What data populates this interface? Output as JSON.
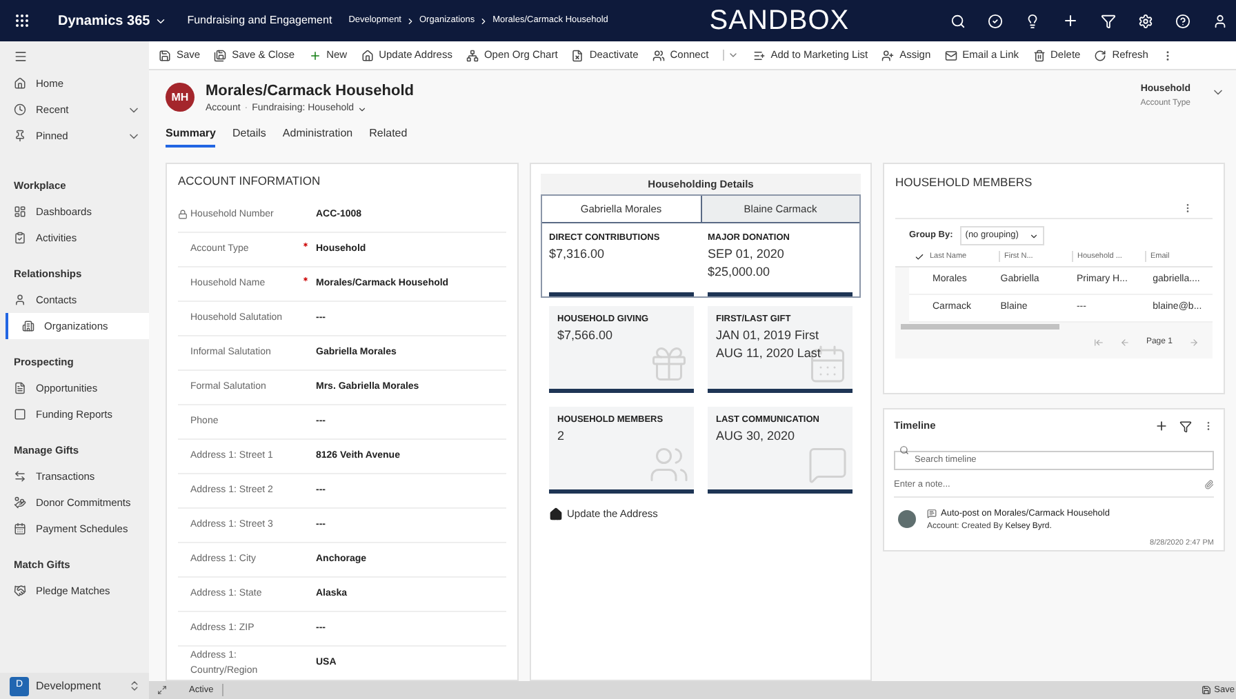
{
  "top_bar": {
    "app_name": "Dynamics 365",
    "area": "Fundraising and Engagement",
    "breadcrumbs": [
      "Development",
      "Organizations",
      "Morales/Carmack Household"
    ],
    "environment": "SANDBOX"
  },
  "command_bar": [
    "Save",
    "Save & Close",
    "New",
    "Update Address",
    "Open Org Chart",
    "Deactivate",
    "Connect",
    "Add to Marketing List",
    "Assign",
    "Email a Link",
    "Delete",
    "Refresh"
  ],
  "sidebar": {
    "top_items": [
      {
        "label": "Home",
        "expandable": false
      },
      {
        "label": "Recent",
        "expandable": true
      },
      {
        "label": "Pinned",
        "expandable": true
      }
    ],
    "groups": [
      {
        "title": "Workplace",
        "items": [
          {
            "label": "Dashboards",
            "selected": false
          },
          {
            "label": "Activities",
            "selected": false
          }
        ]
      },
      {
        "title": "Relationships",
        "items": [
          {
            "label": "Contacts",
            "selected": false
          },
          {
            "label": "Organizations",
            "selected": true
          }
        ]
      },
      {
        "title": "Prospecting",
        "items": [
          {
            "label": "Opportunities",
            "selected": false
          },
          {
            "label": "Funding Reports",
            "selected": false
          }
        ]
      },
      {
        "title": "Manage Gifts",
        "items": [
          {
            "label": "Transactions",
            "selected": false
          },
          {
            "label": "Donor Commitments",
            "selected": false
          },
          {
            "label": "Payment Schedules",
            "selected": false
          }
        ]
      },
      {
        "title": "Match Gifts",
        "items": [
          {
            "label": "Pledge Matches",
            "selected": false
          }
        ]
      }
    ],
    "area_switcher": {
      "badge": "D",
      "label": "Development"
    }
  },
  "record": {
    "initials": "MH",
    "title": "Morales/Carmack Household",
    "entity": "Account",
    "separator": "·",
    "form": "Fundraising: Household",
    "header_field": {
      "value": "Household",
      "label": "Account Type"
    }
  },
  "tabs": [
    {
      "label": "Summary",
      "selected": true
    },
    {
      "label": "Details",
      "selected": false
    },
    {
      "label": "Administration",
      "selected": false
    },
    {
      "label": "Related",
      "selected": false
    }
  ],
  "account_information": {
    "title": "ACCOUNT INFORMATION",
    "fields": [
      {
        "label": "Household Number",
        "value": "ACC-1008",
        "locked": true,
        "required": false
      },
      {
        "label": "Account Type",
        "value": "Household",
        "locked": false,
        "required": true
      },
      {
        "label": "Household Name",
        "value": "Morales/Carmack Household",
        "locked": false,
        "required": true
      },
      {
        "label": "Household Salutation",
        "value": "---",
        "locked": false,
        "required": false
      },
      {
        "label": "Informal Salutation",
        "value": "Gabriella Morales",
        "locked": false,
        "required": false
      },
      {
        "label": "Formal Salutation",
        "value": "Mrs. Gabriella Morales",
        "locked": false,
        "required": false
      },
      {
        "label": "Phone",
        "value": "---",
        "locked": false,
        "required": false
      },
      {
        "label": "Address 1: Street 1",
        "value": "8126 Veith Avenue",
        "locked": false,
        "required": false
      },
      {
        "label": "Address 1: Street 2",
        "value": "---",
        "locked": false,
        "required": false
      },
      {
        "label": "Address 1: Street 3",
        "value": "---",
        "locked": false,
        "required": false
      },
      {
        "label": "Address 1: City",
        "value": "Anchorage",
        "locked": false,
        "required": false
      },
      {
        "label": "Address 1: State",
        "value": "Alaska",
        "locked": false,
        "required": false
      },
      {
        "label": "Address 1: ZIP",
        "value": "---",
        "locked": false,
        "required": false
      },
      {
        "label": "Address 1: Country/Region",
        "value": "USA",
        "locked": false,
        "required": false
      }
    ]
  },
  "householding": {
    "title": "Householding Details",
    "members": [
      {
        "label": "Gabriella Morales",
        "selected": true
      },
      {
        "label": "Blaine Carmack",
        "selected": false
      }
    ],
    "member_tiles": [
      {
        "title": "DIRECT CONTRIBUTIONS",
        "lines": [
          "$7,316.00"
        ]
      },
      {
        "title": "MAJOR DONATION",
        "lines": [
          "SEP 01, 2020",
          "$25,000.00"
        ]
      }
    ],
    "household_tiles": [
      {
        "title": "HOUSEHOLD GIVING",
        "lines": [
          "$7,566.00"
        ],
        "kind": "gift"
      },
      {
        "title": "FIRST/LAST GIFT",
        "lines": [
          "JAN 01, 2019 First",
          "AUG 11, 2020 Last"
        ],
        "kind": "calendar"
      },
      {
        "title": "HOUSEHOLD MEMBERS",
        "lines": [
          "2"
        ],
        "kind": "people"
      },
      {
        "title": "LAST COMMUNICATION",
        "lines": [
          "AUG 30, 2020"
        ],
        "kind": "chat"
      }
    ],
    "link": "Update the Address"
  },
  "household_members": {
    "title": "HOUSEHOLD MEMBERS",
    "group_by_label": "Group By:",
    "group_by_value": "(no grouping)",
    "columns": [
      "Last Name",
      "First N...",
      "Household ...",
      "Email"
    ],
    "rows": [
      [
        "Morales",
        "Gabriella",
        "Primary H...",
        "gabriella...."
      ],
      [
        "Carmack",
        "Blaine",
        "---",
        "blaine@b..."
      ]
    ],
    "page": "Page 1"
  },
  "timeline": {
    "title": "Timeline",
    "search_placeholder": "Search timeline",
    "note_placeholder": "Enter a note...",
    "entries": [
      {
        "title": "Auto-post on Morales/Carmack Household",
        "prefix": "Account: Created By ",
        "author": "Kelsey Byrd.",
        "time": "8/28/2020 2:47 PM"
      }
    ]
  },
  "status_bar": {
    "status": "Active",
    "save": "Save"
  }
}
